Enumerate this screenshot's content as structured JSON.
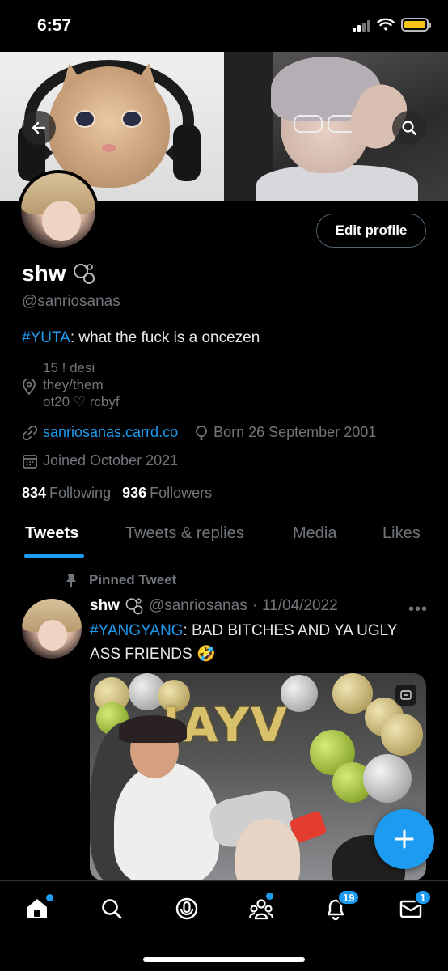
{
  "status_bar": {
    "time": "6:57"
  },
  "profile": {
    "display_name": "shw",
    "handle": "@sanriosanas",
    "edit_button": "Edit profile",
    "bio_hashtag": "#YUTA",
    "bio_text": ": what the fuck is a oncezen",
    "location_lines": [
      "15 ! desi",
      "they/them",
      "ot20 ♡ rcbyf"
    ],
    "link": "sanriosanas.carrd.co",
    "birthday": "Born 26 September 2001",
    "joined": "Joined October 2021",
    "following_count": "834",
    "following_label": "Following",
    "followers_count": "936",
    "followers_label": "Followers"
  },
  "tabs": [
    {
      "label": "Tweets",
      "active": true
    },
    {
      "label": "Tweets & replies",
      "active": false
    },
    {
      "label": "Media",
      "active": false
    },
    {
      "label": "Likes",
      "active": false
    }
  ],
  "pinned_tweet": {
    "pinned_label": "Pinned Tweet",
    "name": "shw",
    "handle": "@sanriosanas",
    "separator": "·",
    "date": "11/04/2022",
    "hashtag": "#YANGYANG",
    "text": ": BAD BITCHES AND YA UGLY ASS FRIENDS 🤣",
    "media_text": "IAYV"
  },
  "bottom_nav": {
    "notifications_badge": "19",
    "messages_badge": "1"
  },
  "colors": {
    "accent": "#1d9bf0",
    "background": "#000000",
    "secondary_text": "#71767b",
    "primary_text": "#e7e9ea"
  }
}
